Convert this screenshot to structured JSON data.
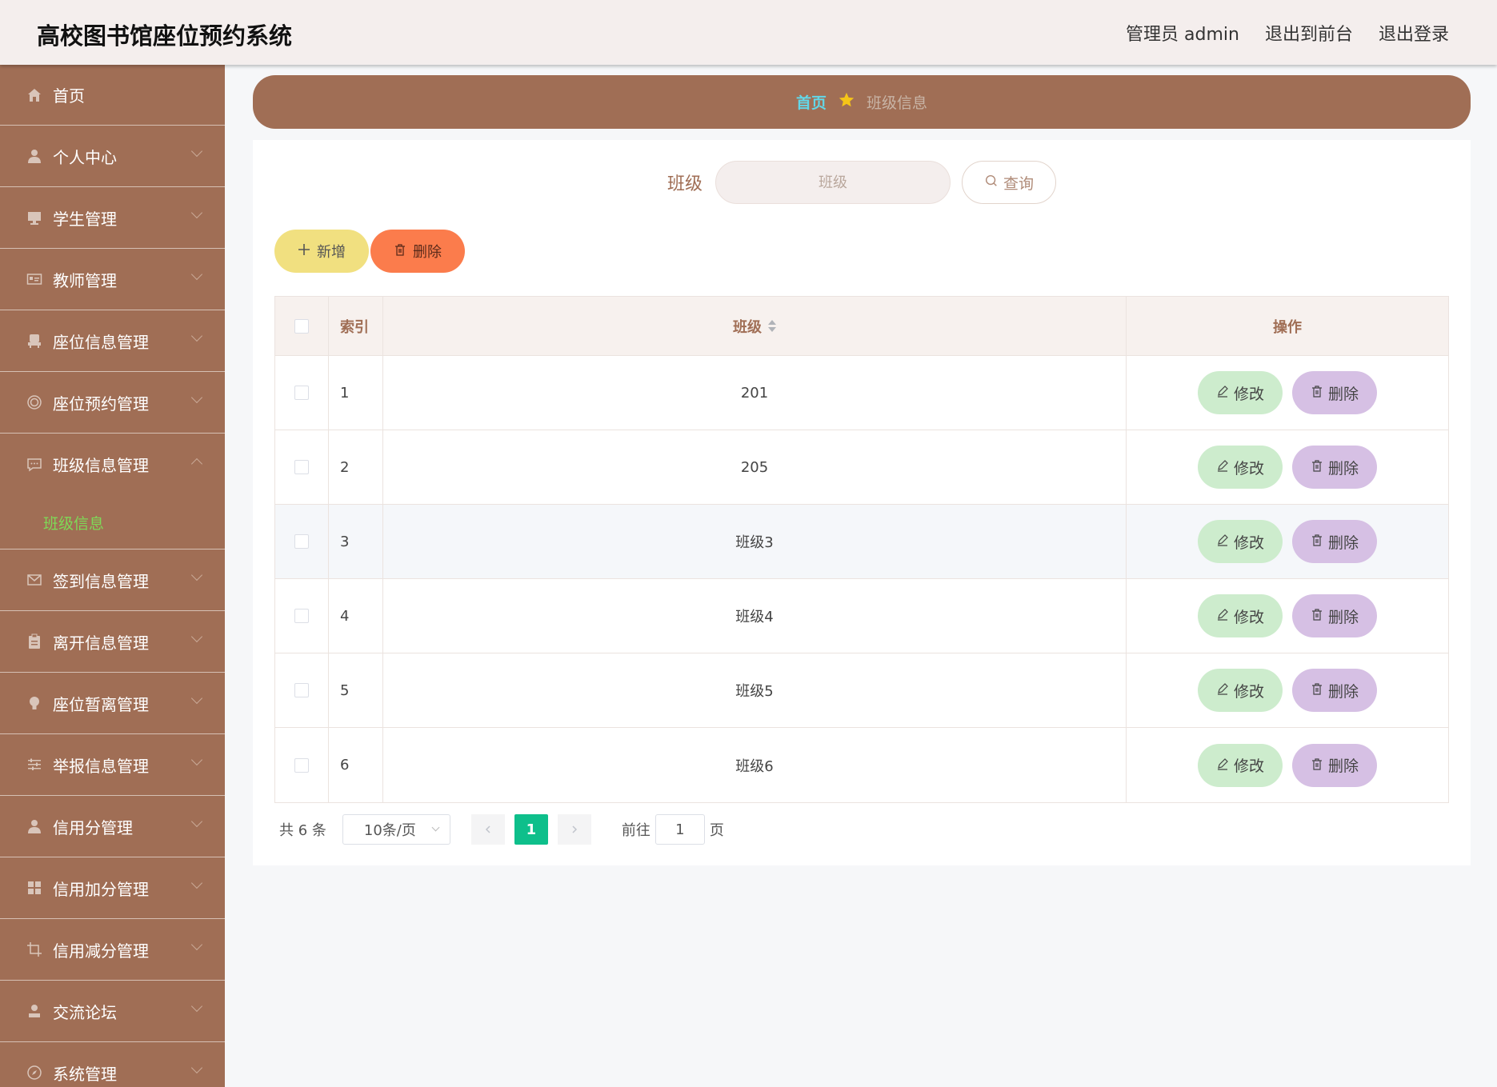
{
  "header": {
    "title": "高校图书馆座位预约系统",
    "user": "管理员 admin",
    "to_front": "退出到前台",
    "logout": "退出登录"
  },
  "sidebar": {
    "items": [
      {
        "label": "首页",
        "icon": "home-icon"
      },
      {
        "label": "个人中心",
        "icon": "user-icon"
      },
      {
        "label": "学生管理",
        "icon": "monitor-icon"
      },
      {
        "label": "教师管理",
        "icon": "id-card-icon"
      },
      {
        "label": "座位信息管理",
        "icon": "seat-icon"
      },
      {
        "label": "座位预约管理",
        "icon": "target-icon"
      },
      {
        "label": "班级信息管理",
        "icon": "chat-icon"
      },
      {
        "label": "签到信息管理",
        "icon": "mail-icon"
      },
      {
        "label": "离开信息管理",
        "icon": "clipboard-icon"
      },
      {
        "label": "座位暂离管理",
        "icon": "bulb-icon"
      },
      {
        "label": "举报信息管理",
        "icon": "sliders-icon"
      },
      {
        "label": "信用分管理",
        "icon": "user-icon"
      },
      {
        "label": "信用加分管理",
        "icon": "grid-icon"
      },
      {
        "label": "信用减分管理",
        "icon": "crop-icon"
      },
      {
        "label": "交流论坛",
        "icon": "user-icon"
      },
      {
        "label": "系统管理",
        "icon": "compass-icon"
      }
    ],
    "submenu_active": "班级信息"
  },
  "breadcrumb": {
    "home": "首页",
    "current": "班级信息"
  },
  "search": {
    "label": "班级",
    "placeholder": "班级",
    "button": "查询"
  },
  "actions": {
    "add": "新增",
    "delete": "删除"
  },
  "table": {
    "headers": {
      "index": "索引",
      "class": "班级",
      "ops": "操作"
    },
    "rows": [
      {
        "index": "1",
        "class": "201"
      },
      {
        "index": "2",
        "class": "205"
      },
      {
        "index": "3",
        "class": "班级3"
      },
      {
        "index": "4",
        "class": "班级4"
      },
      {
        "index": "5",
        "class": "班级5"
      },
      {
        "index": "6",
        "class": "班级6"
      }
    ],
    "edit_label": "修改",
    "delete_label": "删除"
  },
  "pagination": {
    "total": "共 6 条",
    "page_size": "10条/页",
    "current_page": "1",
    "goto_label": "前往",
    "goto_value": "1",
    "page_suffix": "页"
  },
  "colors": {
    "sidebar": "#a06e55",
    "header": "#f4eeed",
    "accent_green": "#0ebf8b",
    "active_submenu": "#7ed957"
  }
}
